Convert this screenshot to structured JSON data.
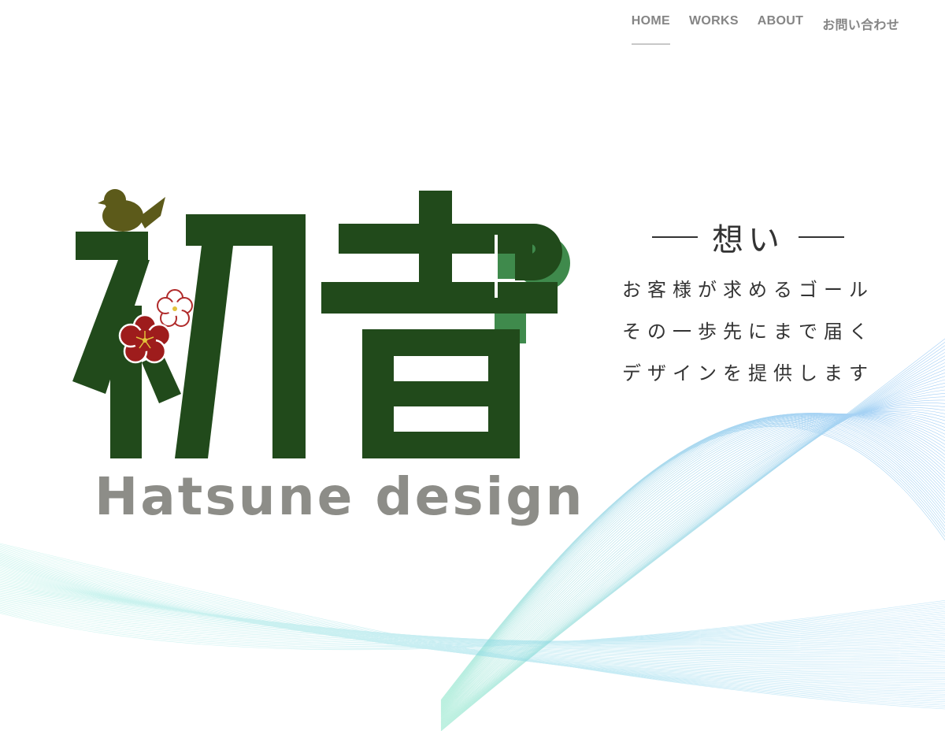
{
  "nav": {
    "items": [
      {
        "label": "HOME",
        "active": true
      },
      {
        "label": "WORKS",
        "active": false
      },
      {
        "label": "ABOUT",
        "active": false
      },
      {
        "label": "お問い合わせ",
        "active": false
      }
    ]
  },
  "logo": {
    "kanji": "初音",
    "wordmark": "Hatsune design"
  },
  "concept": {
    "heading": "想い",
    "lines": [
      "お客様が求めるゴール",
      "その一歩先にまで届く",
      "デザインを提供します"
    ]
  },
  "colors": {
    "logo_green": "#214a1b",
    "logo_accent_green": "#3f8a4c",
    "bird": "#5c5a1a",
    "plum_red": "#9e1c1c",
    "wordmark_gray": "#8d8d88",
    "text": "#333333",
    "nav_text": "#858585"
  }
}
